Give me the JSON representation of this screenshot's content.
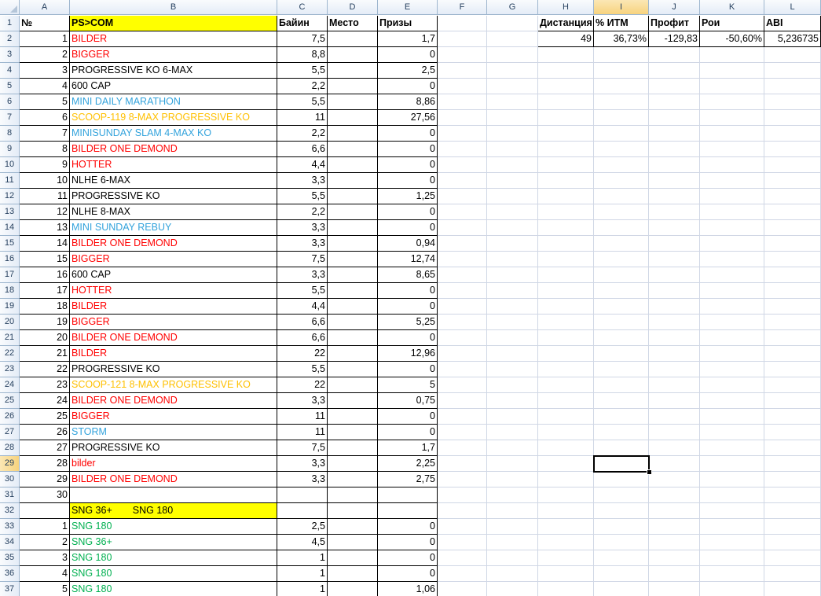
{
  "columns": [
    "A",
    "B",
    "C",
    "D",
    "E",
    "F",
    "G",
    "H",
    "I",
    "J",
    "K",
    "L"
  ],
  "selected_cell": "I29",
  "header_row": {
    "A": "№",
    "B": "PS>COM",
    "C": "Байин",
    "D": "Место",
    "E": "Призы",
    "H": "Дистанция",
    "I": "% ИТМ",
    "J": "Профит",
    "K": "Рои",
    "L": "ABI"
  },
  "stats_row": {
    "H": "49",
    "I": "36,73%",
    "J": "-129,83",
    "K": "-50,60%",
    "L": "5,236735"
  },
  "rows": [
    {
      "num": "1",
      "name": "BILDER",
      "color": "red",
      "buyin": "7,5",
      "prize": "1,7"
    },
    {
      "num": "2",
      "name": "BIGGER",
      "color": "red",
      "buyin": "8,8",
      "prize": "0"
    },
    {
      "num": "3",
      "name": "PROGRESSIVE KO 6-MAX",
      "color": "black",
      "buyin": "5,5",
      "prize": "2,5"
    },
    {
      "num": "4",
      "name": "600 CAP",
      "color": "black",
      "buyin": "2,2",
      "prize": "0"
    },
    {
      "num": "5",
      "name": "MINI DAILY MARATHON",
      "color": "blue",
      "buyin": "5,5",
      "prize": "8,86"
    },
    {
      "num": "6",
      "name": "SCOOP-119 8-MAX PROGRESSIVE KO",
      "color": "orange",
      "buyin": "11",
      "prize": "27,56"
    },
    {
      "num": "7",
      "name": "MINISUNDAY SLAM 4-MAX KO",
      "color": "blue",
      "buyin": "2,2",
      "prize": "0"
    },
    {
      "num": "8",
      "name": "BILDER ONE DEMOND",
      "color": "red",
      "buyin": "6,6",
      "prize": "0"
    },
    {
      "num": "9",
      "name": "HOTTER",
      "color": "red",
      "buyin": "4,4",
      "prize": "0"
    },
    {
      "num": "10",
      "name": "NLHE 6-MAX",
      "color": "black",
      "buyin": "3,3",
      "prize": "0"
    },
    {
      "num": "11",
      "name": "PROGRESSIVE KO",
      "color": "black",
      "buyin": "5,5",
      "prize": "1,25"
    },
    {
      "num": "12",
      "name": "NLHE 8-MAX",
      "color": "black",
      "buyin": "2,2",
      "prize": "0"
    },
    {
      "num": "13",
      "name": "MINI SUNDAY REBUY",
      "color": "blue",
      "buyin": "3,3",
      "prize": "0"
    },
    {
      "num": "14",
      "name": "BILDER ONE DEMOND",
      "color": "red",
      "buyin": "3,3",
      "prize": "0,94"
    },
    {
      "num": "15",
      "name": "BIGGER",
      "color": "red",
      "buyin": "7,5",
      "prize": "12,74"
    },
    {
      "num": "16",
      "name": "600 CAP",
      "color": "black",
      "buyin": "3,3",
      "prize": "8,65"
    },
    {
      "num": "17",
      "name": "HOTTER",
      "color": "red",
      "buyin": "5,5",
      "prize": "0"
    },
    {
      "num": "18",
      "name": "BILDER",
      "color": "red",
      "buyin": "4,4",
      "prize": "0"
    },
    {
      "num": "19",
      "name": "BIGGER",
      "color": "red",
      "buyin": "6,6",
      "prize": "5,25"
    },
    {
      "num": "20",
      "name": "BILDER ONE DEMOND",
      "color": "red",
      "buyin": "6,6",
      "prize": "0"
    },
    {
      "num": "21",
      "name": "BILDER",
      "color": "red",
      "buyin": "22",
      "prize": "12,96"
    },
    {
      "num": "22",
      "name": "PROGRESSIVE KO",
      "color": "black",
      "buyin": "5,5",
      "prize": "0"
    },
    {
      "num": "23",
      "name": "SCOOP-121 8-MAX PROGRESSIVE KO",
      "color": "orange",
      "buyin": "22",
      "prize": "5"
    },
    {
      "num": "24",
      "name": "BILDER ONE DEMOND",
      "color": "red",
      "buyin": "3,3",
      "prize": "0,75"
    },
    {
      "num": "25",
      "name": "BIGGER",
      "color": "red",
      "buyin": "11",
      "prize": "0"
    },
    {
      "num": "26",
      "name": "STORM",
      "color": "blue",
      "buyin": "11",
      "prize": "0"
    },
    {
      "num": "27",
      "name": "PROGRESSIVE KO",
      "color": "black",
      "buyin": "7,5",
      "prize": "1,7"
    },
    {
      "num": "28",
      "name": "bilder",
      "color": "red",
      "buyin": "3,3",
      "prize": "2,25"
    },
    {
      "num": "29",
      "name": "BILDER ONE DEMOND",
      "color": "red",
      "buyin": "3,3",
      "prize": "2,75"
    },
    {
      "num": "30",
      "name": "",
      "color": "black",
      "buyin": "",
      "prize": ""
    }
  ],
  "sng_header": {
    "label1": "SNG 36+",
    "label2": "SNG 180"
  },
  "sng_rows": [
    {
      "num": "1",
      "name": "SNG 180",
      "buyin": "2,5",
      "prize": "0"
    },
    {
      "num": "2",
      "name": "SNG 36+",
      "buyin": "4,5",
      "prize": "0"
    },
    {
      "num": "3",
      "name": "SNG 180",
      "buyin": "1",
      "prize": "0"
    },
    {
      "num": "4",
      "name": "SNG 180",
      "buyin": "1",
      "prize": "0"
    },
    {
      "num": "5",
      "name": "SNG 180",
      "buyin": "1",
      "prize": "1,06"
    }
  ]
}
